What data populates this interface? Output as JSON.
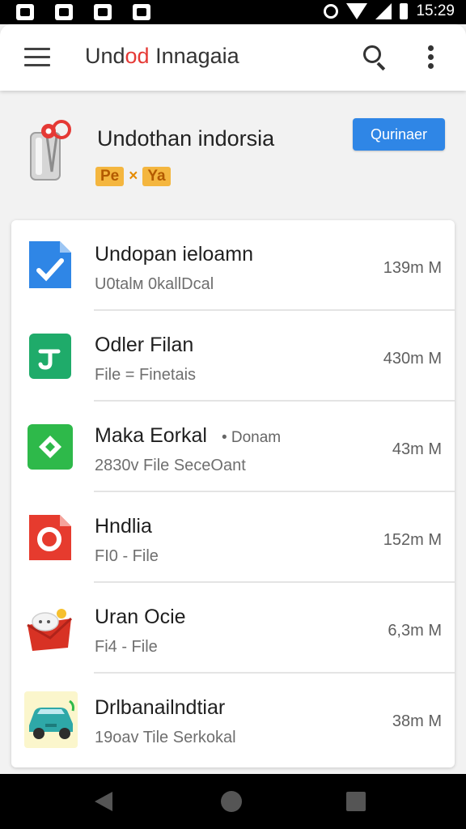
{
  "status_bar": {
    "time": "15:29",
    "icons": [
      "image-icon",
      "sync-icon",
      "gallery-icon",
      "chat-icon",
      "alarm-icon",
      "bluetooth-icon",
      "wifi-icon",
      "signal-icon",
      "battery-icon"
    ]
  },
  "app_bar": {
    "title_start": "Und",
    "title_accent": "od",
    "title_end": " Innagaia",
    "accent_color": "#e53935",
    "icons": [
      "menu-icon",
      "search-icon",
      "more-vert-icon"
    ]
  },
  "header": {
    "title": "Undothan indorsia",
    "badge_left": "Pe",
    "badge_sep": "×",
    "badge_right": "Ya",
    "button_label": "Qurinaer",
    "button_color": "#2f86e6",
    "icon": "paperclip-pin-icon"
  },
  "files": [
    {
      "name": "Undopan ieloamn",
      "tag": "",
      "meta": "U0talм 0kallDcal",
      "size": "139m M",
      "icon": "document-check-icon"
    },
    {
      "name": "Odler Filan",
      "tag": "",
      "meta": "File = Finetais",
      "size": "430m M",
      "icon": "green-document-icon"
    },
    {
      "name": "Maka Eorkal",
      "tag": "• Donam",
      "meta": "2830v File SeceOant",
      "size": "43m M",
      "icon": "green-diamond-icon"
    },
    {
      "name": "Hndlia",
      "tag": "",
      "meta": "FI0 - File",
      "size": "152m M",
      "icon": "red-document-icon"
    },
    {
      "name": "Uran Ocie",
      "tag": "",
      "meta": "Fi4 - File",
      "size": "6,3m M",
      "icon": "red-envelope-icon"
    },
    {
      "name": "Drlbanailndtiar",
      "tag": "",
      "meta": "19oav Tile Serkokal",
      "size": "38m M",
      "icon": "car-image-icon"
    }
  ],
  "nav_bar": {
    "icons": [
      "back-icon",
      "home-icon",
      "recent-apps-icon"
    ]
  }
}
